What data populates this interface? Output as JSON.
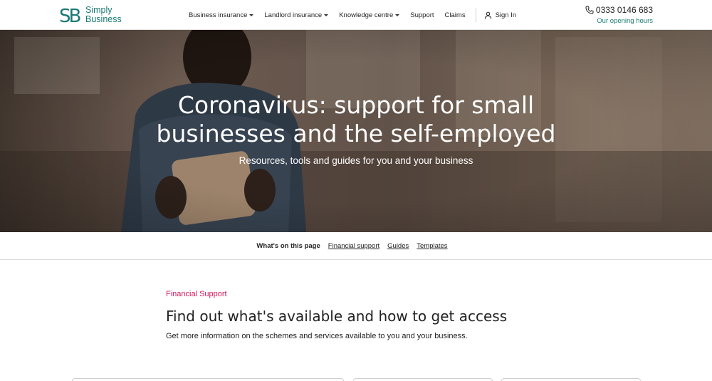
{
  "header": {
    "logo_line1": "Simply",
    "logo_line2": "Business",
    "nav": [
      {
        "label": "Business insurance",
        "has_caret": true
      },
      {
        "label": "Landlord insurance",
        "has_caret": true
      },
      {
        "label": "Knowledge centre",
        "has_caret": true
      },
      {
        "label": "Support",
        "has_caret": false
      },
      {
        "label": "Claims",
        "has_caret": false
      }
    ],
    "sign_in": "Sign In",
    "phone": "0333 0146 683",
    "opening_hours": "Our opening hours",
    "brand_color": "#1a7a73"
  },
  "hero": {
    "title_line1": "Coronavirus: support for small",
    "title_line2": "businesses and the self-employed",
    "subtitle": "Resources, tools and guides for you and your business"
  },
  "page_nav": {
    "label": "What's on this page",
    "links": [
      "Financial support",
      "Guides",
      "Templates"
    ]
  },
  "section": {
    "eyebrow": "Financial Support",
    "eyebrow_color": "#d0185e",
    "title": "Find out what's available and how to get access",
    "description": "Get more information on the schemes and services available to you and your business."
  },
  "icons": {
    "phone": "phone-icon",
    "user": "user-icon",
    "caret": "chevron-down-icon"
  }
}
